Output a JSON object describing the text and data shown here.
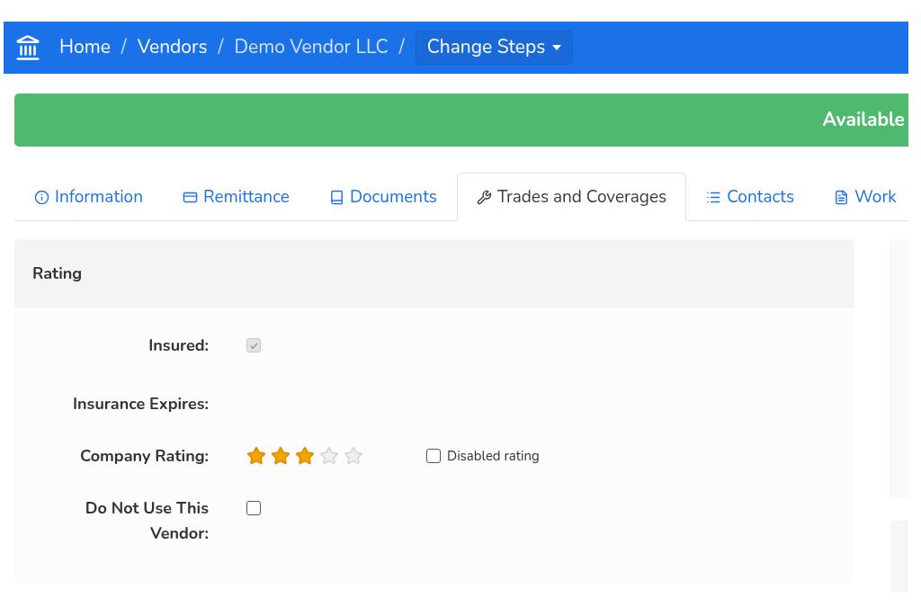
{
  "breadcrumb": [
    {
      "label": "Home",
      "current": false,
      "separator": "/"
    },
    {
      "label": "Vendors",
      "current": false,
      "separator": "/"
    },
    {
      "label": "Demo Vendor LLC",
      "current": true,
      "separator": "/"
    }
  ],
  "steps_button": {
    "label": "Change Steps"
  },
  "status_banner": {
    "text": "Available"
  },
  "tabs": [
    {
      "label": "Information",
      "kind": "info",
      "selected": false
    },
    {
      "label": "Remittance",
      "kind": "card",
      "selected": false
    },
    {
      "label": "Documents",
      "kind": "book",
      "selected": false
    },
    {
      "label": "Trades and Coverages",
      "kind": "wrench",
      "selected": true
    },
    {
      "label": "Contacts",
      "kind": "list",
      "selected": false
    },
    {
      "label": "Work",
      "kind": "file",
      "selected": false
    }
  ],
  "panel": {
    "title": "Rating",
    "fields": [
      {
        "label": "Insured:",
        "kind": "checkbox",
        "checked": true,
        "disabled": true
      },
      {
        "label": "Insurance Expires:",
        "kind": "date"
      },
      {
        "label": "Company Rating:",
        "kind": "rating",
        "stars": 3,
        "option": {
          "label": "Disabled rating",
          "checked": false
        }
      },
      {
        "label": "Do Not Use This Vendor:",
        "kind": "checkbox",
        "checked": false,
        "disabled": false
      }
    ]
  }
}
